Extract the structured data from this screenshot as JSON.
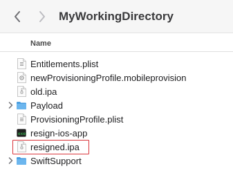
{
  "toolbar": {
    "back_icon": "chevron-left-icon",
    "forward_icon": "chevron-right-icon",
    "title": "MyWorkingDirectory"
  },
  "columns": {
    "name": "Name"
  },
  "files": [
    {
      "name": "Entitlements.plist",
      "kind": "plist-file-icon",
      "expandable": false
    },
    {
      "name": "newProvisioningProfile.mobileprovision",
      "kind": "provisioning-file-icon",
      "expandable": false
    },
    {
      "name": "old.ipa",
      "kind": "archive-file-icon",
      "expandable": false
    },
    {
      "name": "Payload",
      "kind": "folder-icon",
      "expandable": true
    },
    {
      "name": "ProvisioningProfile.plist",
      "kind": "plist-file-icon",
      "expandable": false
    },
    {
      "name": "resign-ios-app",
      "kind": "terminal-executable-icon",
      "expandable": false
    },
    {
      "name": "resigned.ipa",
      "kind": "archive-file-icon",
      "expandable": false,
      "highlighted": true
    },
    {
      "name": "SwiftSupport",
      "kind": "folder-icon",
      "expandable": true
    }
  ],
  "colors": {
    "folder": "#5aa9e6",
    "highlight_border": "#d9343a",
    "toolbar_bg": "#f6f6f6"
  }
}
